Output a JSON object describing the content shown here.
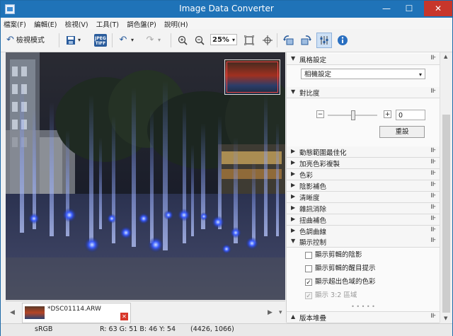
{
  "window": {
    "title": "Image Data Converter",
    "minimize": "—",
    "maximize": "☐",
    "close": "✕"
  },
  "menu": [
    "檔案(F)",
    "編輯(E)",
    "檢視(V)",
    "工具(T)",
    "調色盤(P)",
    "說明(H)"
  ],
  "toolbar": {
    "view_mode_label": "檢視模式",
    "zoom_value": "25%",
    "jpeg_tiff_label": "JPEG TIFF"
  },
  "filmstrip": {
    "file_name": "*DSC01114.ARW"
  },
  "status": {
    "color_space": "sRGB",
    "pixel_values": "R: 63  G: 51  B: 46  Y: 54",
    "coordinates": "(4426, 1066)"
  },
  "panel": {
    "style_header": "風格設定",
    "style_value": "相機設定",
    "contrast_header": "對比度",
    "contrast_value": "0",
    "reset_label": "重設",
    "sections": [
      "動態範圍最佳化",
      "加亮色彩複製",
      "色彩",
      "陰影補色",
      "清晰度",
      "雜訊消除",
      "扭曲補色",
      "色調曲線"
    ],
    "display_header": "顯示控制",
    "options": [
      {
        "label": "顯示剪輯的陰影",
        "checked": false,
        "disabled": false
      },
      {
        "label": "顯示剪輯的醒目提示",
        "checked": false,
        "disabled": false
      },
      {
        "label": "顯示超出色域的色彩",
        "checked": true,
        "disabled": false
      },
      {
        "label": "顯示 3:2 區域",
        "checked": true,
        "disabled": true
      }
    ],
    "history_header": "版本堆疊"
  },
  "colors": {
    "titlebar": "#1f73b8",
    "close": "#c7362b"
  }
}
